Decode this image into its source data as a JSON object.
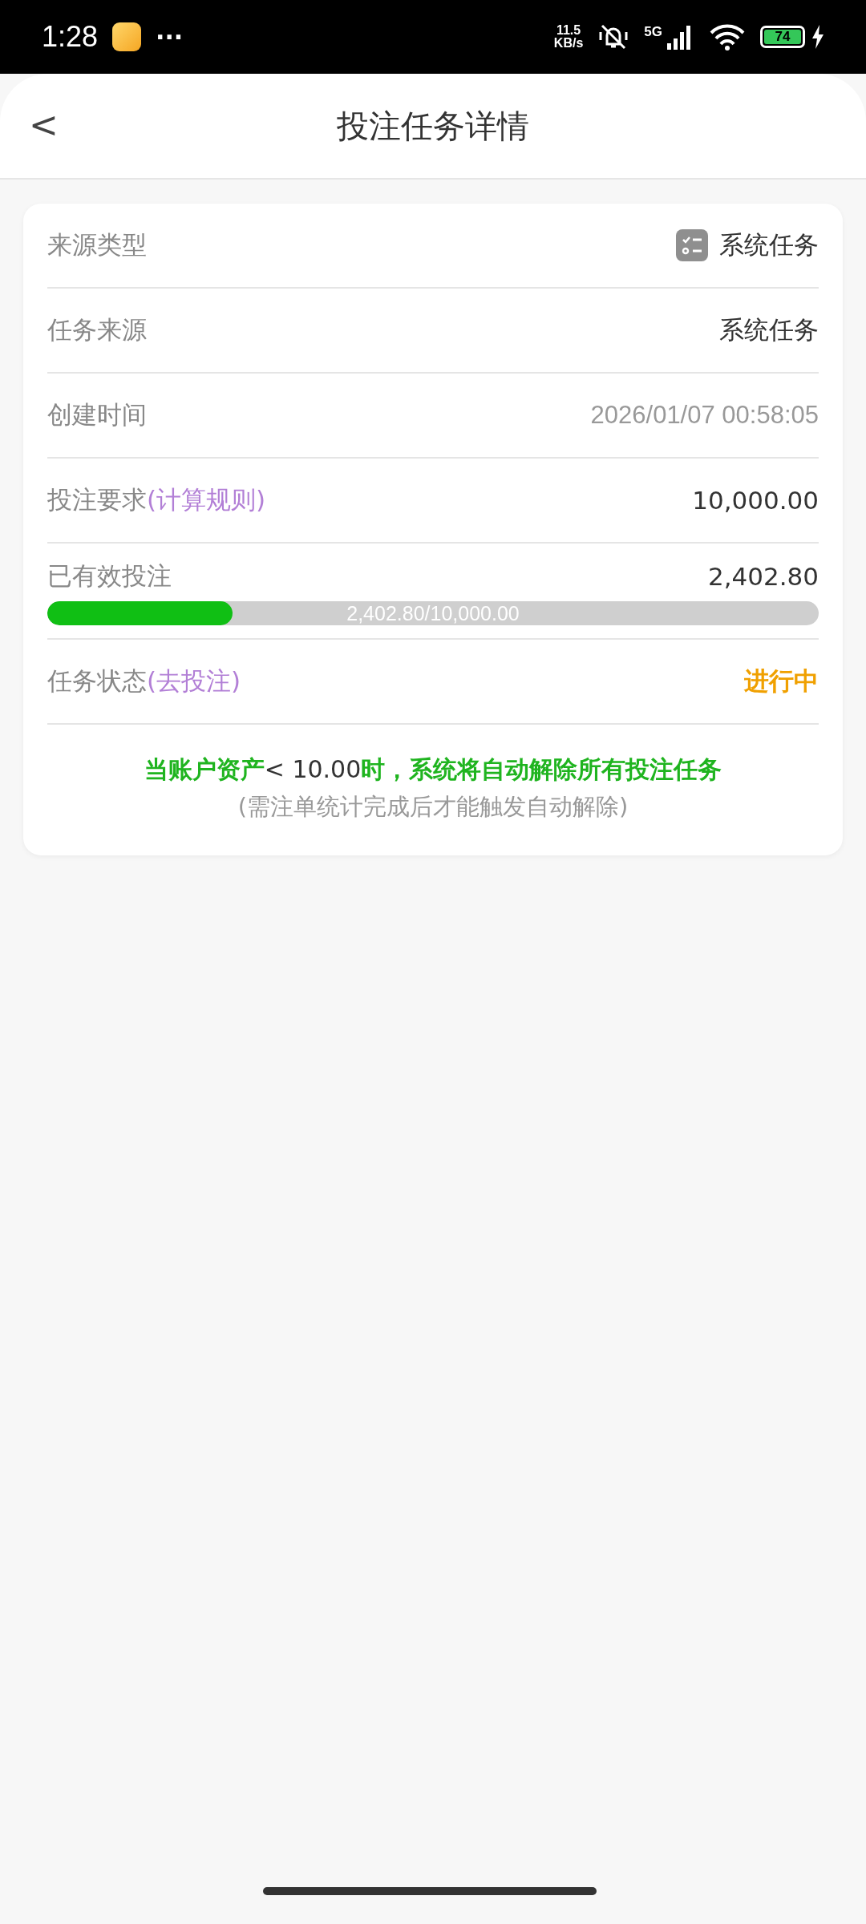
{
  "status_bar": {
    "time": "1:28",
    "more": "···",
    "speed": "11.5",
    "speed_unit": "KB/s",
    "network": "5G",
    "battery": "74",
    "charging": true
  },
  "header": {
    "back": "<",
    "title": "投注任务详情"
  },
  "rows": [
    {
      "kind": "icon",
      "label": "来源类型",
      "value": "系统任务"
    },
    {
      "kind": "text",
      "label": "任务来源",
      "value": "系统任务"
    },
    {
      "kind": "muted",
      "label": "创建时间",
      "value": "2026/01/07 00:58:05"
    },
    {
      "kind": "text",
      "label": "投注要求",
      "link": "(计算规则)",
      "value": "10,000.00"
    },
    {
      "kind": "progress",
      "label": "已有效投注",
      "value": "2,402.80",
      "level": 0.24028,
      "bar_text": "2,402.80/10,000.00"
    },
    {
      "kind": "status",
      "label": "任务状态",
      "link": "(去投注)",
      "value": "进行中"
    }
  ],
  "notice": {
    "before": "当账户资产",
    "amount": "< 10.00",
    "after": "时，系统将自动解除所有投注任务",
    "note": "(需注单统计完成后才能触发自动解除)"
  }
}
